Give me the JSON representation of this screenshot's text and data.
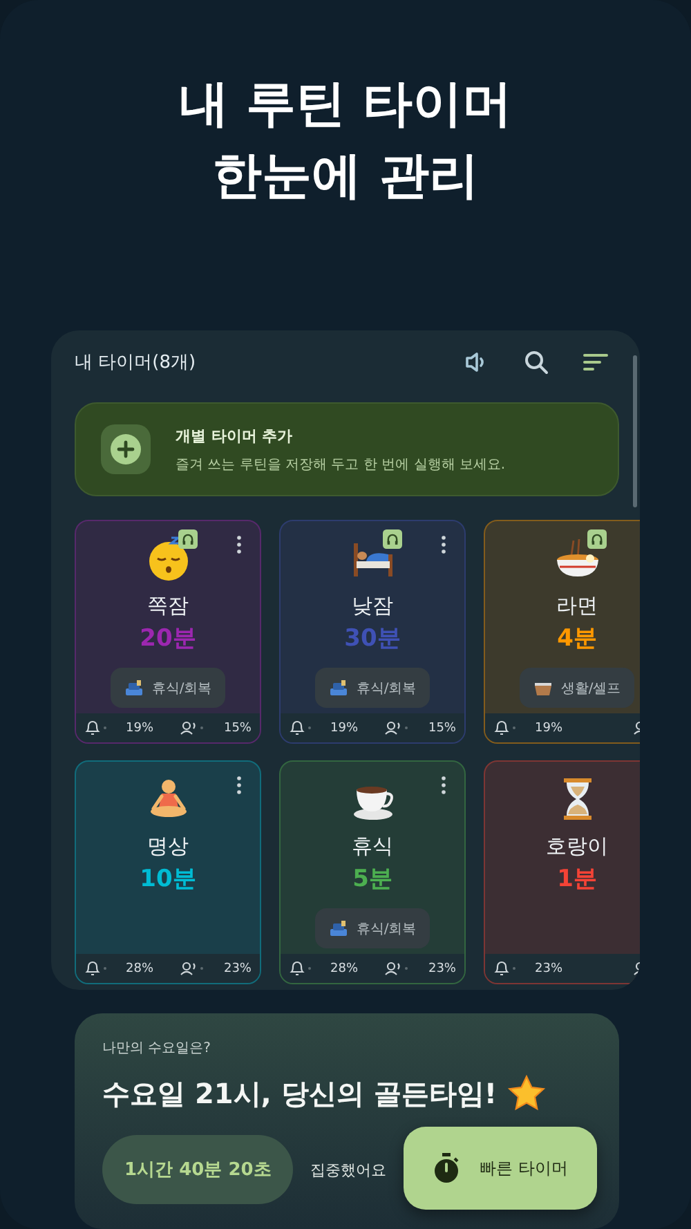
{
  "headline": [
    "내 루틴 타이머",
    "한눈에 관리"
  ],
  "panel": {
    "title": "내 타이머(8개)",
    "add_banner": {
      "title": "개별 타이머 추가",
      "description": "즐겨 쓰는 루틴을 저장해 두고 한 번에 실행해 보세요."
    },
    "timers": [
      {
        "kind": "sleepy-face",
        "name": "쪽잠",
        "duration": "20분",
        "color": "#9c27b0",
        "headphones": true,
        "category": {
          "kind": "sofa",
          "label": "휴식/회복"
        },
        "alarm": "19%",
        "voice": "15%"
      },
      {
        "kind": "bed",
        "name": "낮잠",
        "duration": "30분",
        "color": "#3f51b5",
        "headphones": true,
        "category": {
          "kind": "sofa",
          "label": "휴식/회복"
        },
        "alarm": "19%",
        "voice": "15%"
      },
      {
        "kind": "noodle-bowl",
        "name": "라면",
        "duration": "4분",
        "color": "#ff9800",
        "headphones": true,
        "category": {
          "kind": "basket",
          "label": "생활/셀프"
        },
        "alarm": "19%"
      },
      {
        "kind": "meditation",
        "name": "명상",
        "duration": "10분",
        "color": "#00bcd4",
        "headphones": false,
        "alarm": "28%",
        "voice": "23%"
      },
      {
        "kind": "coffee",
        "name": "휴식",
        "duration": "5분",
        "color": "#4caf50",
        "headphones": false,
        "category": {
          "kind": "sofa",
          "label": "휴식/회복"
        },
        "alarm": "28%",
        "voice": "23%"
      },
      {
        "kind": "hourglass",
        "name": "호랑이",
        "duration": "1분",
        "color": "#f44336",
        "headphones": false,
        "alarm": "23%"
      }
    ]
  },
  "insight": {
    "question": "나만의 수요일은?",
    "headline": "수요일 21시, 당신의 골든타임!",
    "focus_time": "1시간 40분 20초",
    "focus_label": "집중했어요"
  },
  "quick_button": "빠른 타이머"
}
